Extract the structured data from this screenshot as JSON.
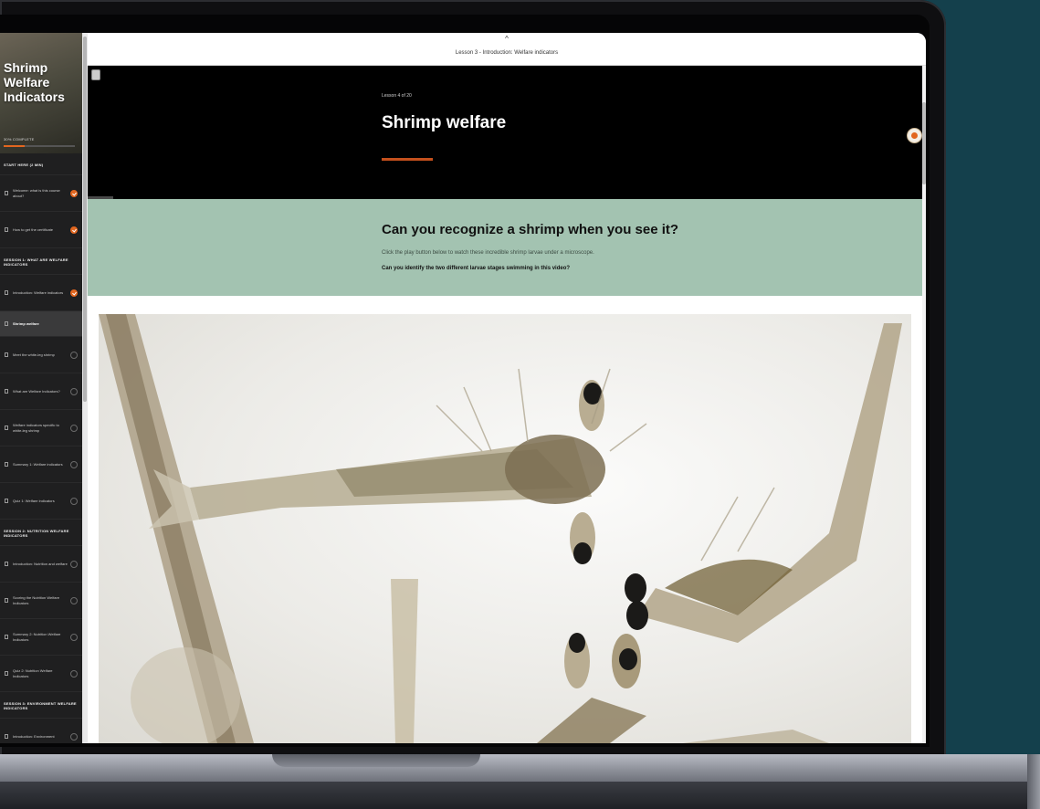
{
  "course": {
    "title_lines": [
      "Shrimp",
      "Welfare",
      "Indicators"
    ],
    "complete_label": "30% COMPLETE",
    "progress_fraction": 0.3
  },
  "sidebar": {
    "sections": [
      {
        "label": "START HERE (2 MIN)",
        "items": [
          {
            "label": "Welcome: what is this course about?",
            "status": "done"
          },
          {
            "label": "How to get the certificate",
            "status": "done"
          }
        ]
      },
      {
        "label": "SESSION 1: WHAT ARE WELFARE INDICATORS",
        "items": [
          {
            "label": "Introduction: Welfare indicators",
            "status": "done"
          },
          {
            "label": "Shrimp welfare",
            "status": "active"
          },
          {
            "label": "Meet the white-leg shrimp",
            "status": "todo"
          },
          {
            "label": "What are Welfare Indicators?",
            "status": "todo"
          },
          {
            "label": "Welfare indicators specific to white-leg shrimp",
            "status": "todo"
          },
          {
            "label": "Summary 1: Welfare indicators",
            "status": "todo"
          },
          {
            "label": "Quiz 1: Welfare indicators",
            "status": "todo"
          }
        ]
      },
      {
        "label": "SESSION 2: NUTRITION WELFARE INDICATORS",
        "items": [
          {
            "label": "Introduction: Nutrition and welfare",
            "status": "todo"
          },
          {
            "label": "Scoring the Nutrition Welfare Indicators",
            "status": "todo"
          },
          {
            "label": "Summary 2: Nutrition Welfare Indicators",
            "status": "todo"
          },
          {
            "label": "Quiz 2: Nutrition Welfare Indicators",
            "status": "todo"
          }
        ]
      },
      {
        "label": "SESSION 3: ENVIRONMENT WELFARE INDICATORS",
        "items": [
          {
            "label": "Introduction: Environment",
            "status": "todo"
          }
        ]
      }
    ]
  },
  "topbar": {
    "caret": "^",
    "crumb": "Lesson 3 - Introduction: Welfare indicators"
  },
  "lesson": {
    "number": "Lesson 4 of 20",
    "title": "Shrimp welfare"
  },
  "band": {
    "title": "Can you recognize a shrimp when you see it?",
    "text": "Click the play button below to watch these incredible shrimp larvae under a microscope.",
    "question": "Can you identify the two different larvae stages swimming in this video?"
  },
  "colors": {
    "accent": "#e2661f",
    "band_bg": "#a3c3b1",
    "hero_bg": "#000000",
    "sidebar_bg": "#1f1f20",
    "page_bg": "#14404c"
  },
  "icons": [
    "menu-icon",
    "document-icon",
    "check-circle-icon",
    "empty-circle-icon",
    "chevron-up-icon",
    "chat-icon"
  ]
}
